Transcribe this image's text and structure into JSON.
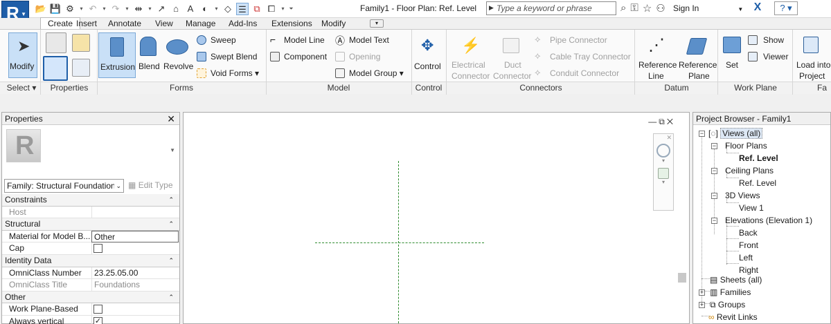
{
  "app": {
    "logo_letter": "R",
    "title": "Family1 - Floor Plan: Ref. Level"
  },
  "search": {
    "placeholder": "Type a keyword or phrase"
  },
  "account": {
    "signin_label": "Sign In"
  },
  "tabs": [
    {
      "label": "Create",
      "active": true
    },
    {
      "label": "Insert"
    },
    {
      "label": "Annotate"
    },
    {
      "label": "View"
    },
    {
      "label": "Manage"
    },
    {
      "label": "Add-Ins"
    },
    {
      "label": "Extensions"
    },
    {
      "label": "Modify"
    }
  ],
  "ribbon": {
    "select": {
      "modify": "Modify",
      "panel": "Select ▾"
    },
    "properties": {
      "panel": "Properties"
    },
    "forms": {
      "panel": "Forms",
      "extrusion": "Extrusion",
      "blend": "Blend",
      "revolve": "Revolve",
      "sweep": "Sweep",
      "swept_blend": "Swept Blend",
      "void_forms": "Void Forms ▾"
    },
    "model": {
      "panel": "Model",
      "model_line": "Model  Line",
      "model_text": "Model  Text",
      "component": "Component",
      "opening": "Opening",
      "model_group": "Model  Group ▾"
    },
    "control": {
      "panel": "Control",
      "control": "Control"
    },
    "connectors": {
      "panel": "Connectors",
      "electrical": "Electrical",
      "electrical2": "Connector",
      "duct": "Duct",
      "duct2": "Connector",
      "pipe": "Pipe  Connector",
      "cable_tray": "Cable Tray  Connector",
      "conduit": "Conduit  Connector"
    },
    "datum": {
      "panel": "Datum",
      "ref_line_1": "Reference",
      "ref_line_2": "Line",
      "ref_plane_1": "Reference",
      "ref_plane_2": "Plane"
    },
    "work_plane": {
      "panel": "Work Plane",
      "set": "Set",
      "show": "Show",
      "viewer": "Viewer"
    },
    "family_editor": {
      "panel": "Fa",
      "load_1": "Load into",
      "load_2": "Project"
    }
  },
  "properties_pane": {
    "title": "Properties",
    "family_select": "Family: Structural Foundation",
    "edit_type": "Edit Type",
    "groups": [
      {
        "name": "Constraints",
        "rows": [
          {
            "k": "Host",
            "v": "",
            "disabled": true
          }
        ]
      },
      {
        "name": "Structural",
        "rows": [
          {
            "k": "Material for Model B...",
            "v": "Other",
            "box": true
          },
          {
            "k": "Cap",
            "check": false
          }
        ]
      },
      {
        "name": "Identity Data",
        "rows": [
          {
            "k": "OmniClass Number",
            "v": "23.25.05.00"
          },
          {
            "k": "OmniClass Title",
            "v": "Foundations",
            "disabled": true
          }
        ]
      },
      {
        "name": "Other",
        "rows": [
          {
            "k": "Work Plane-Based",
            "check": false
          },
          {
            "k": "Always vertical",
            "check": true
          }
        ]
      }
    ]
  },
  "browser": {
    "title": "Project Browser - Family1",
    "views_root": "Views (all)",
    "floor_plans": "Floor Plans",
    "fp_ref_level": "Ref. Level",
    "ceiling_plans": "Ceiling Plans",
    "cp_ref_level": "Ref. Level",
    "views_3d": "3D Views",
    "view1": "View 1",
    "elevations": "Elevations (Elevation 1)",
    "back": "Back",
    "front": "Front",
    "left": "Left",
    "right": "Right",
    "sheets": "Sheets (all)",
    "families": "Families",
    "groups": "Groups",
    "revit_links": "Revit Links"
  },
  "colors": {
    "accent_blue": "#1e5ea8",
    "ref_plane_green": "#2e8b2e",
    "selected_tool_bg": "#c9e0f7"
  }
}
